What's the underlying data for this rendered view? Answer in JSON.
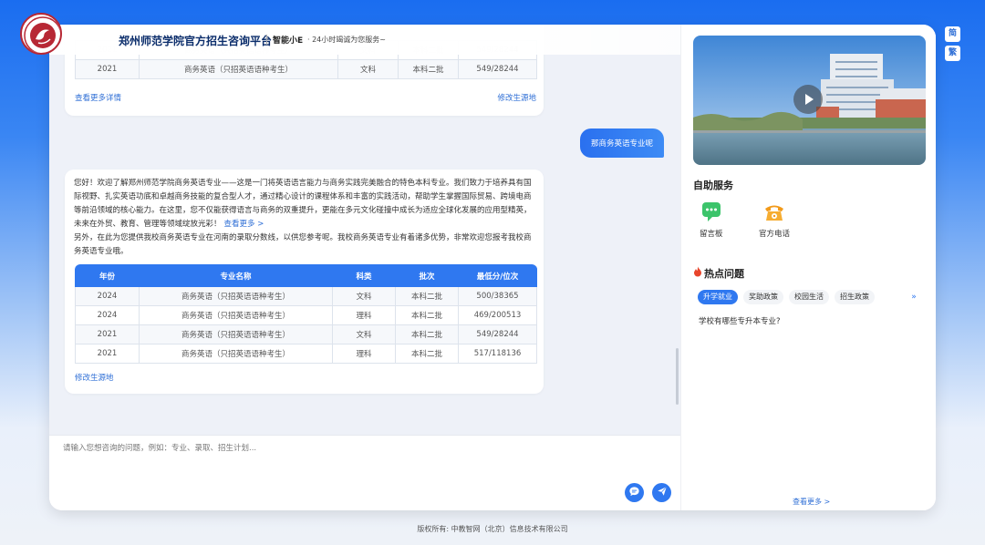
{
  "header": {
    "title": "郑州师范学院官方招生咨询平台",
    "assistant_name": "智能小E",
    "tagline": "· 24小时竭诚为您服务~"
  },
  "chat": {
    "prev_table": {
      "rows": [
        [
          "2021",
          "商务英语（只招英语语种考生）",
          "文科",
          "本科二批",
          "549/28244"
        ]
      ]
    },
    "prev_more_link": "查看更多详情",
    "prev_change_source": "修改生源地",
    "user_message": "那商务英语专业呢",
    "answer_text": "您好！欢迎了解郑州师范学院商务英语专业——这是一门将英语语言能力与商务实践完美融合的特色本科专业。我们致力于培养具有国际视野、扎实英语功底和卓越商务技能的复合型人才，通过精心设计的课程体系和丰富的实践活动，帮助学生掌握国际贸易、跨境电商等前沿领域的核心能力。在这里，您不仅能获得语言与商务的双重提升，更能在多元文化碰撞中成长为适应全球化发展的应用型精英，未来在外贸、教育、管理等领域绽放光彩！",
    "answer_more_link": "查看更多 >",
    "answer_text2": "另外，在此为您提供我校商务英语专业在河南的录取分数线，以供您参考呢。我校商务英语专业有着诸多优势，非常欢迎您报考我校商务英语专业哦。",
    "table": {
      "headers": [
        "年份",
        "专业名称",
        "科类",
        "批次",
        "最低分/位次"
      ],
      "rows": [
        [
          "2024",
          "商务英语（只招英语语种考生）",
          "文科",
          "本科二批",
          "500/38365"
        ],
        [
          "2024",
          "商务英语（只招英语语种考生）",
          "理科",
          "本科二批",
          "469/200513"
        ],
        [
          "2021",
          "商务英语（只招英语语种考生）",
          "文科",
          "本科二批",
          "549/28244"
        ],
        [
          "2021",
          "商务英语（只招英语语种考生）",
          "理科",
          "本科二批",
          "517/118136"
        ]
      ]
    },
    "change_source": "修改生源地"
  },
  "input": {
    "placeholder": "请输入您想咨询的问题，例如：专业、录取、招生计划..."
  },
  "sidebar": {
    "self_service_title": "自助服务",
    "services": [
      {
        "label": "留言板",
        "icon": "message-board-icon"
      },
      {
        "label": "官方电话",
        "icon": "phone-icon"
      }
    ],
    "hot_title": "热点问题",
    "tabs": [
      "升学就业",
      "奖助政策",
      "校园生活",
      "招生政策"
    ],
    "active_tab": "升学就业",
    "questions": [
      "学校有哪些专升本专业?"
    ],
    "see_more": "查看更多 >"
  },
  "lang": {
    "simplified": "简",
    "traditional": "繁"
  },
  "footer": "版权所有: 中教智网（北京）信息技术有限公司",
  "colors": {
    "primary": "#2f78f0",
    "brand_red": "#b72835",
    "title_navy": "#0b2d6b"
  }
}
